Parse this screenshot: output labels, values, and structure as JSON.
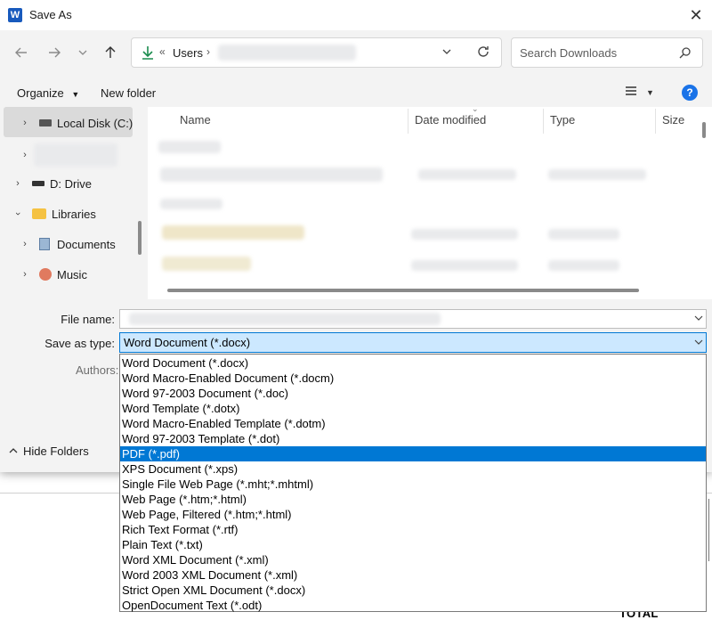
{
  "window": {
    "title": "Save As",
    "app_icon": "word-icon"
  },
  "nav": {
    "breadcrumb_prefix": "«",
    "breadcrumb_users": "Users",
    "search_placeholder": "Search Downloads"
  },
  "toolbar": {
    "organize": "Organize",
    "new_folder": "New folder",
    "help": "?"
  },
  "sidebar": {
    "items": [
      {
        "label": "Local Disk (C:)",
        "icon": "drive-icon"
      },
      {
        "label": "",
        "icon": ""
      },
      {
        "label": "D: Drive",
        "icon": "drive-icon"
      },
      {
        "label": "Libraries",
        "icon": "folder-icon"
      },
      {
        "label": "Documents",
        "icon": "documents-icon"
      },
      {
        "label": "Music",
        "icon": "music-icon"
      }
    ]
  },
  "filelist": {
    "columns": [
      "Name",
      "Date modified",
      "Type",
      "Size"
    ]
  },
  "form": {
    "file_name_label": "File name:",
    "save_as_type_label": "Save as type:",
    "save_as_type_value": "Word Document (*.docx)",
    "authors_label": "Authors:"
  },
  "file_types": [
    "Word Document (*.docx)",
    "Word Macro-Enabled Document (*.docm)",
    "Word 97-2003 Document (*.doc)",
    "Word Template (*.dotx)",
    "Word Macro-Enabled Template (*.dotm)",
    "Word 97-2003 Template (*.dot)",
    "PDF (*.pdf)",
    "XPS Document (*.xps)",
    "Single File Web Page (*.mht;*.mhtml)",
    "Web Page (*.htm;*.html)",
    "Web Page, Filtered (*.htm;*.html)",
    "Rich Text Format (*.rtf)",
    "Plain Text (*.txt)",
    "Word XML Document (*.xml)",
    "Word 2003 XML Document (*.xml)",
    "Strict Open XML Document (*.docx)",
    "OpenDocument Text (*.odt)"
  ],
  "selected_type": "PDF (*.pdf)",
  "footer": {
    "hide_folders": "Hide Folders"
  },
  "background": {
    "total_text": "TOTAL"
  },
  "colors": {
    "accent": "#0078d4",
    "selection_bg": "#cce8ff"
  }
}
